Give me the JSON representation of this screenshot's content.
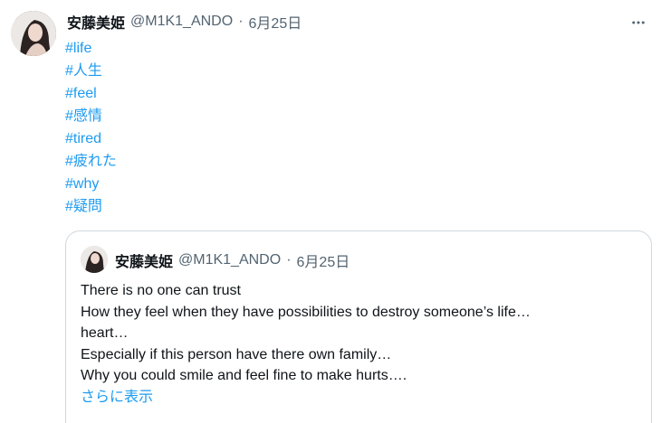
{
  "tweet": {
    "author_name": "安藤美姫",
    "handle": "@M1K1_ANDO",
    "separator": "·",
    "date": "6月25日",
    "more_icon": "more-horizontal-icon",
    "hashtags": [
      "#life",
      "#人生",
      "#feel",
      "#感情",
      "#tired",
      "#疲れた",
      "#why",
      "#疑問"
    ]
  },
  "quote": {
    "author_name": "安藤美姫",
    "handle": "@M1K1_ANDO",
    "separator": "·",
    "date": "6月25日",
    "lines": [
      "There is no one can trust",
      "How they feel when they have possibilities  to destroy someone’s life…",
      "heart…",
      "Especially if this person have there own family…",
      "Why you could smile and feel fine to make hurts…."
    ],
    "show_more": "さらに表示"
  },
  "colors": {
    "link": "#1d9bf0",
    "text": "#0f1419",
    "muted": "#536471",
    "border": "#cfd9de"
  }
}
